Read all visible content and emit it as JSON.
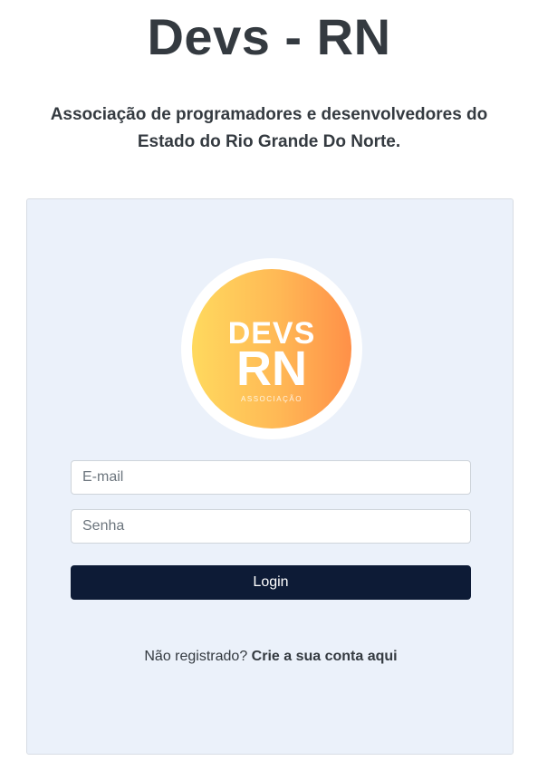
{
  "header": {
    "title": "Devs - RN",
    "subtitle": "Associação de programadores e desenvolvedores do Estado do Rio Grande Do Norte."
  },
  "logo": {
    "line1": "DEVS",
    "line2": "RN",
    "line3": "ASSOCIAÇÃO"
  },
  "form": {
    "email_placeholder": "E-mail",
    "password_placeholder": "Senha",
    "login_label": "Login"
  },
  "register": {
    "prompt": "Não registrado?",
    "link_label": "Crie a sua conta aqui"
  },
  "colors": {
    "card_bg": "#ebf1fa",
    "button_bg": "#0d1b36",
    "text": "#343a40"
  }
}
